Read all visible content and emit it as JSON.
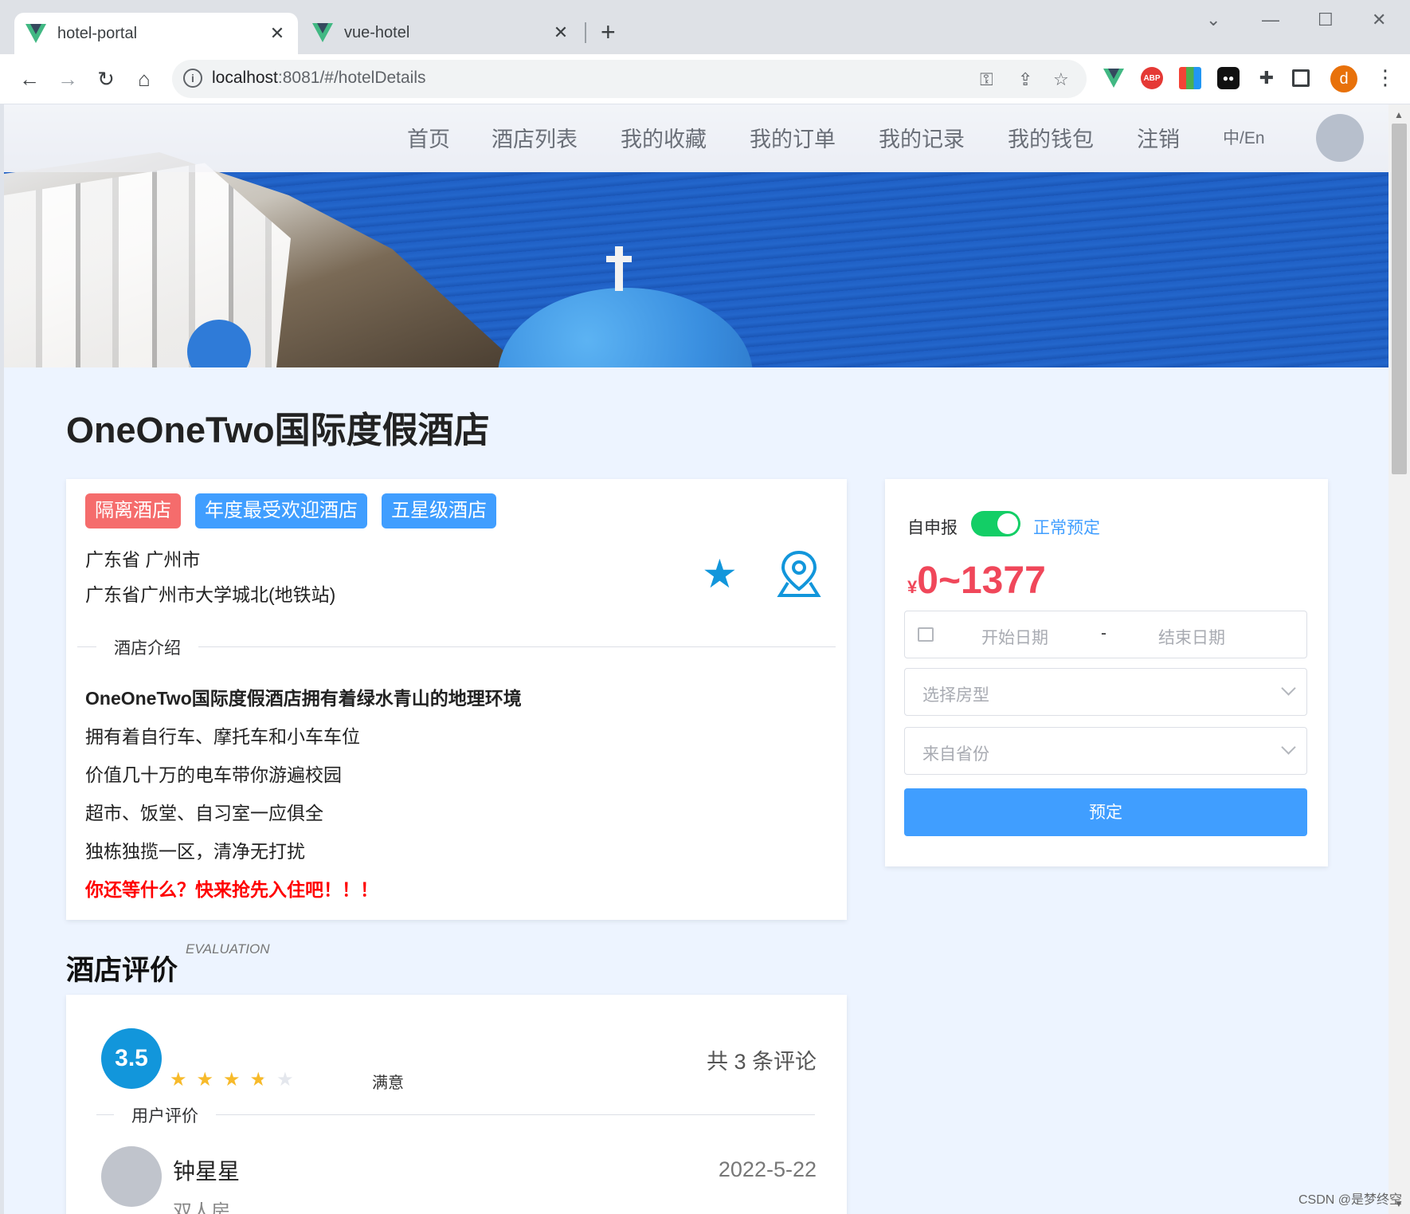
{
  "browser": {
    "tabs": [
      {
        "title": "hotel-portal",
        "active": true
      },
      {
        "title": "vue-hotel",
        "active": false
      }
    ],
    "url_host": "localhost",
    "url_rest": ":8081/#/hotelDetails",
    "profile_initial": "d"
  },
  "nav": {
    "items": [
      "首页",
      "酒店列表",
      "我的收藏",
      "我的订单",
      "我的记录",
      "我的钱包",
      "注销"
    ],
    "lang": "中/En"
  },
  "hotel": {
    "name": "OneOneTwo国际度假酒店",
    "tags": [
      {
        "label": "隔离酒店",
        "color": "#f56c6c"
      },
      {
        "label": "年度最受欢迎酒店",
        "color": "#409eff"
      },
      {
        "label": "五星级酒店",
        "color": "#409eff"
      }
    ],
    "address_line1": "广东省 广州市",
    "address_line2": "广东省广州市大学城北(地铁站)",
    "intro_title": "酒店介绍",
    "intro": [
      "OneOneTwo国际度假酒店拥有着绿水青山的地理环境",
      "拥有着自行车、摩托车和小车车位",
      "价值几十万的电车带你游遍校园",
      "超市、饭堂、自习室一应俱全",
      "独栋独揽一区，清净无打扰",
      "你还等什么？快来抢先入住吧！！！"
    ]
  },
  "booking": {
    "self_report_label": "自申报",
    "switch_on": true,
    "switch_text": "正常预定",
    "currency": "¥",
    "price_range": "0~1377",
    "start_placeholder": "开始日期",
    "separator": "-",
    "end_placeholder": "结束日期",
    "room_placeholder": "选择房型",
    "province_placeholder": "来自省份",
    "submit_label": "预定"
  },
  "evaluation": {
    "title": "酒店评价",
    "subtitle": "EVALUATION",
    "score": "3.5",
    "stars": 3.5,
    "rating_text": "满意",
    "total_text": "共 3 条评论",
    "section_label": "用户评价",
    "comments": [
      {
        "name": "钟星星",
        "date": "2022-5-22",
        "room": "双人房"
      }
    ]
  },
  "watermark": "CSDN @是梦终空"
}
